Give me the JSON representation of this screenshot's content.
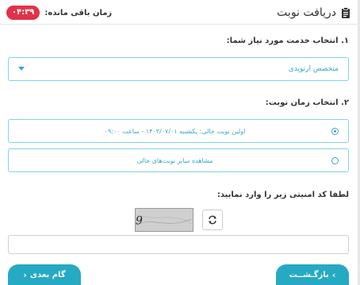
{
  "header": {
    "title": "دریافت نوبت",
    "icon": "clipboard-icon",
    "timer_label": "زمان باقی مانده:",
    "timer_value": "۰۴:۳۹",
    "timer_color": "#e0334a"
  },
  "step1": {
    "label": "۱. انتخاب خدمت مورد نیاز شما:",
    "selected_value": "متخصص ارتوپدی"
  },
  "step2": {
    "label": "۲. انتخاب زمان نوبت:",
    "options": [
      {
        "text": "اولین نوبت خالی: یکشنبه ۱۴۰۳/۰۷/۰۱ - ساعت ۰۹:۰۰",
        "selected": true
      },
      {
        "text": "مشاهده سایر نوبت‌های خالی",
        "selected": false
      }
    ]
  },
  "captcha": {
    "label": "لطفا کد امنیتی زیر را وارد نمایید:",
    "code": "14469",
    "input_value": ""
  },
  "buttons": {
    "back_label": "بازگـشــت",
    "next_label": "گام بعدی"
  },
  "colors": {
    "accent": "#26a9c2",
    "border": "#7fd3e6",
    "badge": "#e0334a"
  }
}
